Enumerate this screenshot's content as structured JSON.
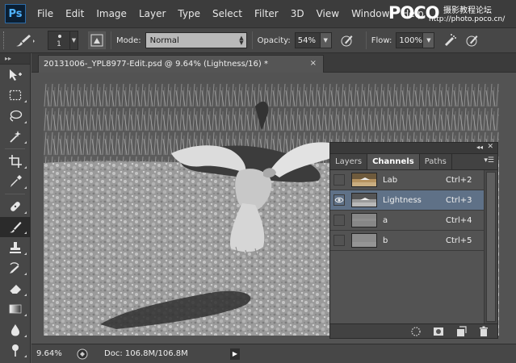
{
  "app": {
    "logo": "Ps",
    "menu": [
      "File",
      "Edit",
      "Image",
      "Layer",
      "Type",
      "Select",
      "Filter",
      "3D",
      "View",
      "Window",
      "Help"
    ]
  },
  "watermark": {
    "logo": "POCO",
    "tagline": "摄影教程论坛",
    "url": "http://photo.poco.cn/"
  },
  "options": {
    "brush_size": "1",
    "mode_label": "Mode:",
    "mode_value": "Normal",
    "opacity_label": "Opacity:",
    "opacity_value": "54%",
    "flow_label": "Flow:",
    "flow_value": "100%"
  },
  "document": {
    "tab_title": "20131006-_YPL8977-Edit.psd @ 9.64% (Lightness/16) *",
    "close": "×"
  },
  "status": {
    "zoom": "9.64%",
    "doc_info": "Doc: 106.8M/106.8M"
  },
  "channels_panel": {
    "collapse": "◂◂",
    "close": "✕",
    "tabs": [
      "Layers",
      "Channels",
      "Paths"
    ],
    "active_tab": "Channels",
    "channels": [
      {
        "name": "Lab",
        "shortcut": "Ctrl+2",
        "visible": false,
        "selected": false
      },
      {
        "name": "Lightness",
        "shortcut": "Ctrl+3",
        "visible": true,
        "selected": true
      },
      {
        "name": "a",
        "shortcut": "Ctrl+4",
        "visible": false,
        "selected": false
      },
      {
        "name": "b",
        "shortcut": "Ctrl+5",
        "visible": false,
        "selected": false
      }
    ]
  },
  "toolbox": {
    "tools": [
      "move-tool",
      "marquee-tool",
      "lasso-tool",
      "magic-wand-tool",
      "crop-tool",
      "eyedropper-tool",
      "healing-brush-tool",
      "brush-tool",
      "clone-stamp-tool",
      "history-brush-tool",
      "eraser-tool",
      "gradient-tool",
      "blur-tool",
      "dodge-tool"
    ],
    "active_tool": "brush-tool"
  }
}
